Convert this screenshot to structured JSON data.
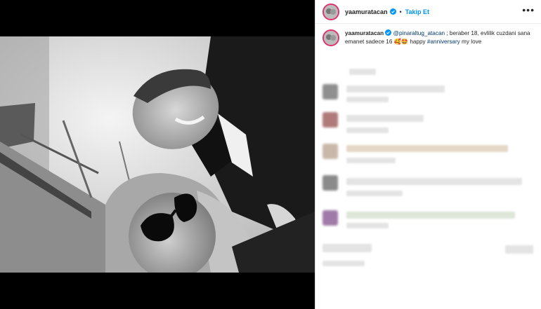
{
  "post": {
    "username": "yaamuratacan",
    "follow_label": "Takip Et",
    "separator": "•",
    "more_label": "•••"
  },
  "caption": {
    "username": "yaamuratacan",
    "mention": "@pinaraltug_atacan",
    "text_before_emoji": " ; beraber 18, evlilik cuzdani sana emanet sadece 16 ",
    "emojis": "🥰🤩",
    "text_after_emoji": " happy ",
    "hashtag": "#anniversary",
    "text_end": " my love"
  },
  "colors": {
    "follow": "#0095f6",
    "link": "#00376b",
    "avatar_ring": "#e1306c"
  }
}
